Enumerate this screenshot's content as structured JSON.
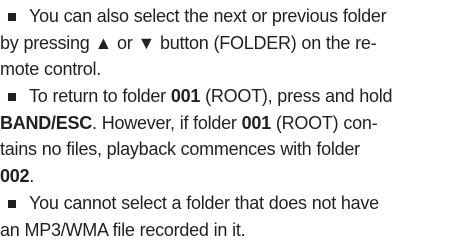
{
  "items": [
    {
      "l1_before": "You can also select the next or previous folder",
      "l2_a": "by pressing ",
      "up_symbol": "▲",
      "l2_or": " or ",
      "down_symbol": "▼",
      "l2_b": " button (FOLDER) on the re-",
      "l3": "mote control."
    },
    {
      "l1_a": "To return to folder ",
      "folder_root": "001",
      "l1_b": " (ROOT), press and hold",
      "button_name": "BAND/ESC",
      "l2_a": ". However, if folder ",
      "folder_root_2": "001",
      "l2_b": " (ROOT) con-",
      "l3": "tains no files, playback commences with folder",
      "folder_next": "002",
      "l4_end": "."
    },
    {
      "l1": "You cannot select a folder that does not have",
      "l2": "an MP3/WMA file recorded in it."
    }
  ]
}
